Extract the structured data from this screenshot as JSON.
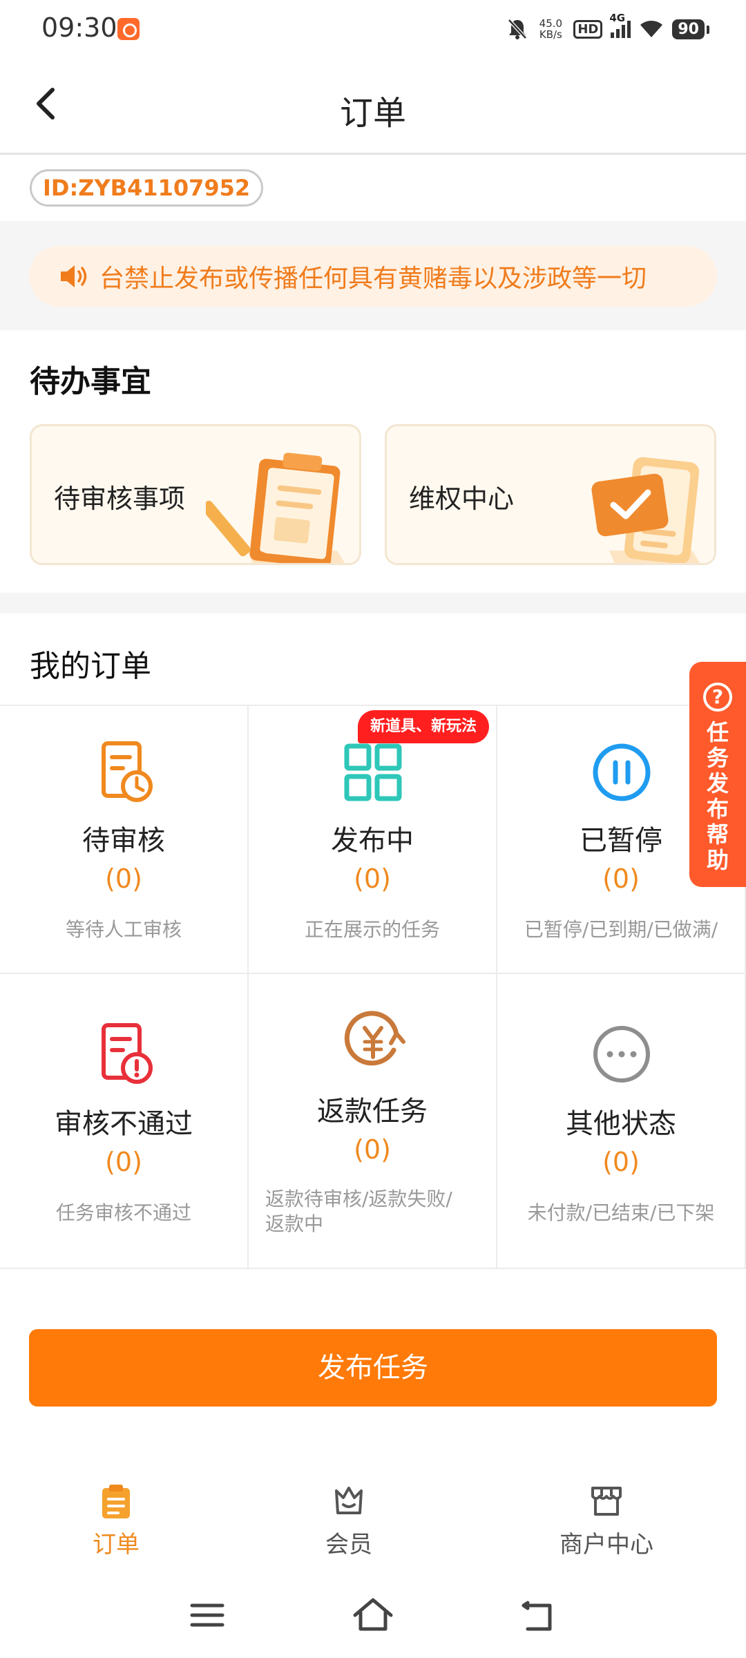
{
  "status_bar": {
    "time": "09:30",
    "net_speed_value": "45.0",
    "net_speed_unit": "KB/s",
    "hd": "HD",
    "network": "4G",
    "battery": "90"
  },
  "header": {
    "title": "订单"
  },
  "account": {
    "id_text": "ID:ZYB41107952"
  },
  "notice": {
    "text": "台禁止发布或传播任何具有黄赌毒以及涉政等一切"
  },
  "todo": {
    "title": "待办事宜",
    "items": [
      {
        "label": "待审核事项"
      },
      {
        "label": "维权中心"
      }
    ]
  },
  "orders": {
    "title": "我的订单",
    "new_badge": "新道具、新玩法",
    "cells": [
      {
        "name": "待审核",
        "count": "(0)",
        "desc": "等待人工审核"
      },
      {
        "name": "发布中",
        "count": "(0)",
        "desc": "正在展示的任务"
      },
      {
        "name": "已暂停",
        "count": "(0)",
        "desc": "已暂停/已到期/已做满/"
      },
      {
        "name": "审核不通过",
        "count": "(0)",
        "desc": "任务审核不通过"
      },
      {
        "name": "返款任务",
        "count": "(0)",
        "desc_line1": "返款待审核/返款失败/",
        "desc_line2": "返款中"
      },
      {
        "name": "其他状态",
        "count": "(0)",
        "desc": "未付款/已结束/已下架"
      }
    ]
  },
  "help_tab": {
    "icon": "?",
    "label": "任务发布帮助"
  },
  "publish_button": {
    "label": "发布任务"
  },
  "bottom_tabs": [
    {
      "label": "订单",
      "active": true
    },
    {
      "label": "会员",
      "active": false
    },
    {
      "label": "商户中心",
      "active": false
    }
  ],
  "colors": {
    "accent": "#ff7a08",
    "count": "#f0891e",
    "badge_red": "#ff1f1f",
    "help_tab": "#ff5a2c"
  }
}
